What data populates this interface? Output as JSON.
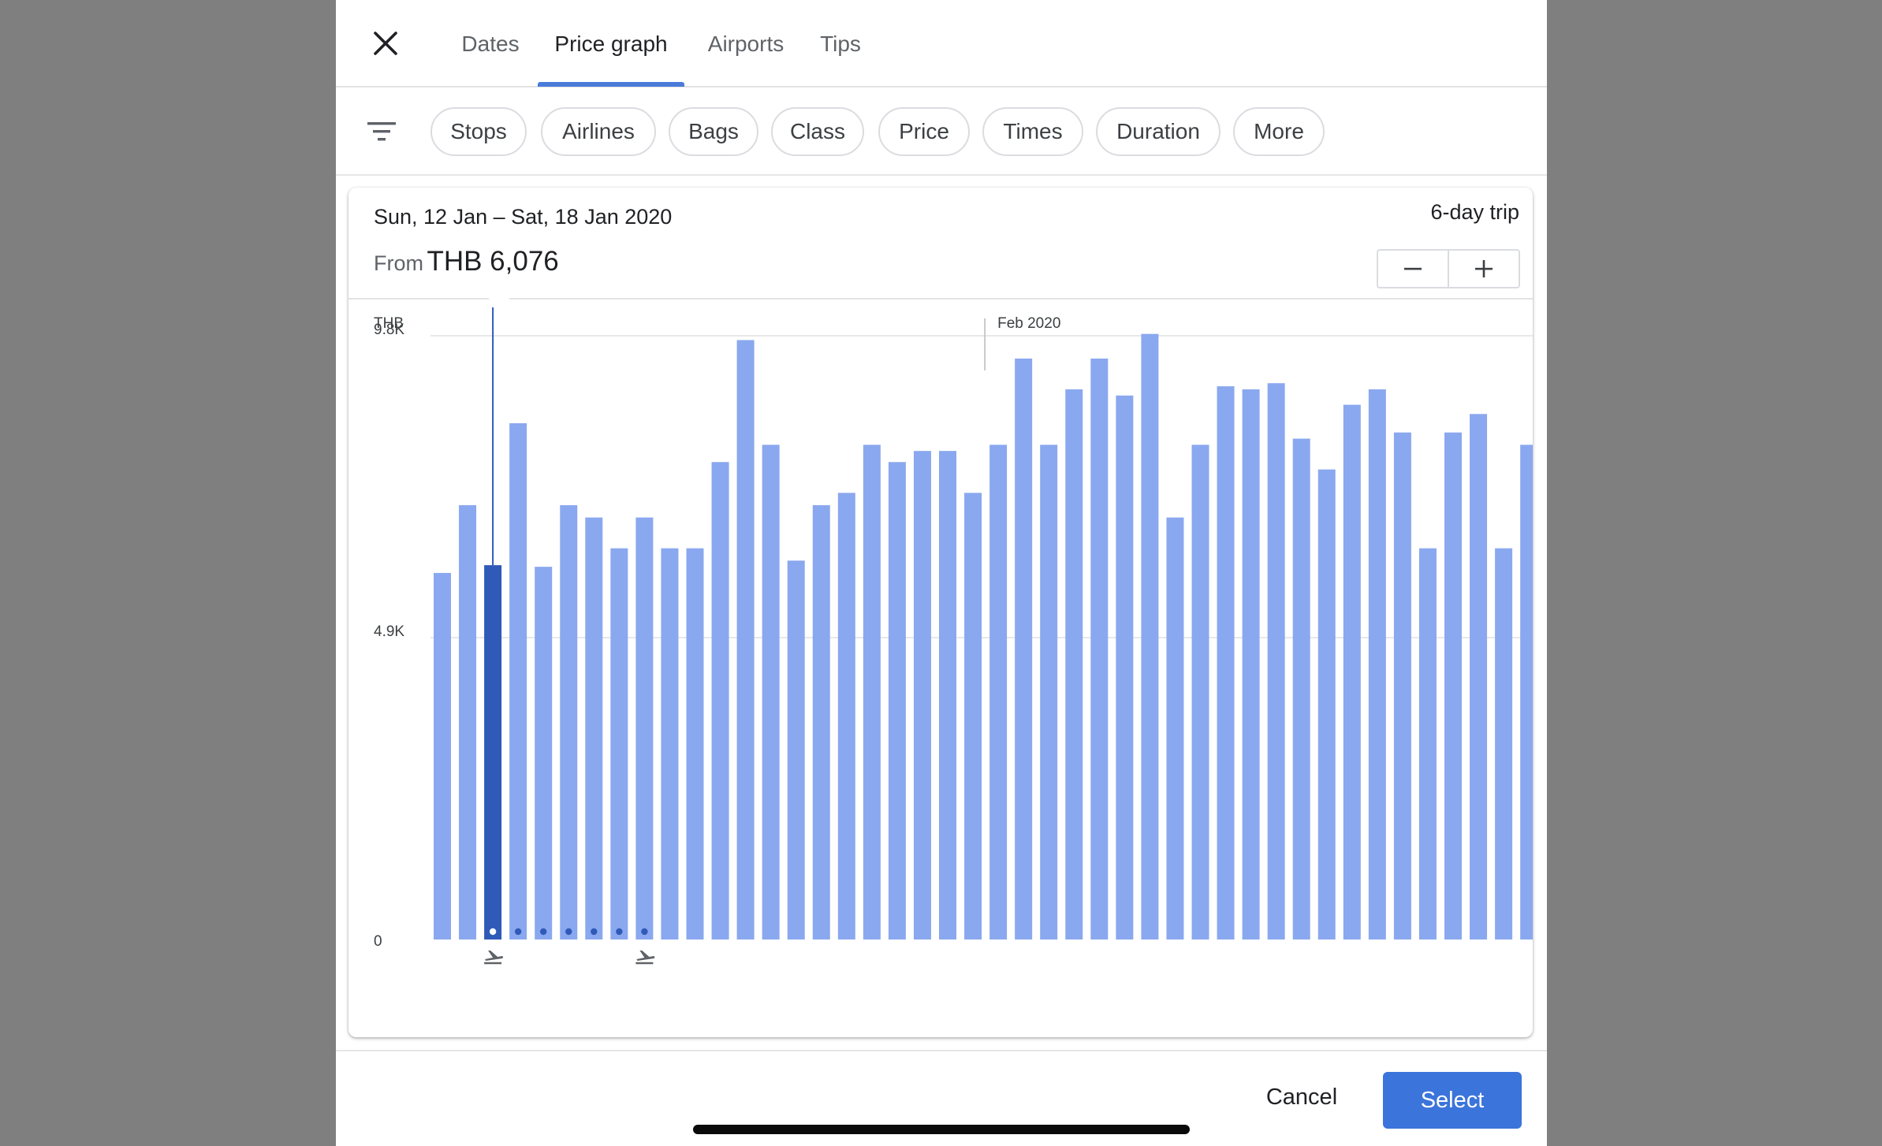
{
  "tabs": [
    {
      "label": "Dates",
      "active": false
    },
    {
      "label": "Price graph",
      "active": true
    },
    {
      "label": "Airports",
      "active": false
    },
    {
      "label": "Tips",
      "active": false
    }
  ],
  "filters": [
    "Stops",
    "Airlines",
    "Bags",
    "Class",
    "Price",
    "Times",
    "Duration",
    "More"
  ],
  "summary": {
    "date_range": "Sun, 12 Jan – Sat, 18 Jan 2020",
    "from_label": "From",
    "price": "THB 6,076",
    "trip_length": "6-day trip"
  },
  "actions": {
    "cancel": "Cancel",
    "select": "Select"
  },
  "colors": {
    "bar": "#8aa8ef",
    "bar_selected": "#2f5ab8",
    "accent": "#3b74db"
  },
  "icons": {
    "close": "close-icon",
    "filter": "filter-icon",
    "minus": "minus-icon",
    "plus": "plus-icon",
    "depart": "departure-icon",
    "return": "arrival-icon"
  },
  "chart_data": {
    "type": "bar",
    "currency_label": "THB",
    "yticks": [
      {
        "value": 0,
        "label": "0"
      },
      {
        "value": 4900,
        "label": "4.9K"
      },
      {
        "value": 9800,
        "label": "9.8K"
      }
    ],
    "ylim": [
      0,
      9800
    ],
    "month_marker": {
      "index": 22,
      "label": "Feb 2020"
    },
    "selected_index": 2,
    "trip_range": [
      2,
      8
    ],
    "values": [
      5950,
      7050,
      6076,
      8380,
      6050,
      7050,
      6850,
      6350,
      6850,
      6350,
      6350,
      7750,
      9730,
      8030,
      6150,
      7050,
      7250,
      8030,
      7750,
      7930,
      7930,
      7250,
      8030,
      9430,
      8030,
      8930,
      9430,
      8830,
      9830,
      6850,
      8030,
      8980,
      8930,
      9030,
      8130,
      7630,
      8680,
      8930,
      8230,
      6350,
      8230,
      8530,
      6350,
      8030
    ]
  }
}
